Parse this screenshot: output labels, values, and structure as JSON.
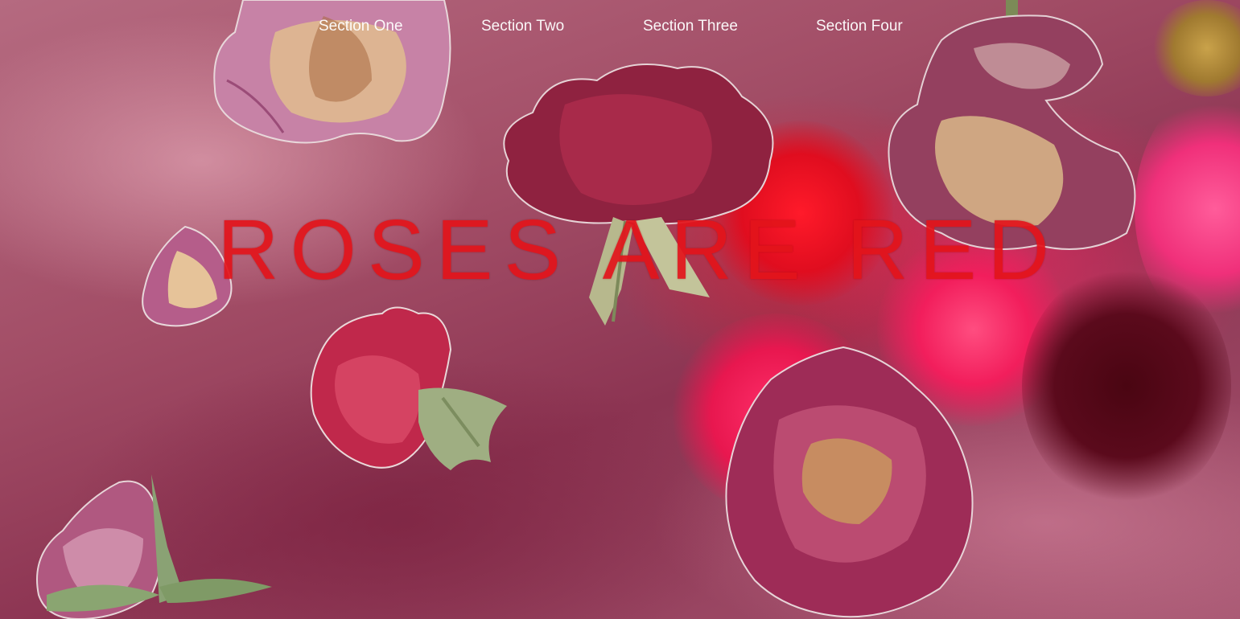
{
  "nav": {
    "items": [
      {
        "label": "Section One"
      },
      {
        "label": "Section Two"
      },
      {
        "label": "Section Three"
      },
      {
        "label": "Section Four"
      }
    ]
  },
  "hero": {
    "title": "ROSES ARE RED"
  },
  "colors": {
    "title": "#e3141b",
    "nav_text": "#ffffff",
    "background": "#a24d66"
  }
}
